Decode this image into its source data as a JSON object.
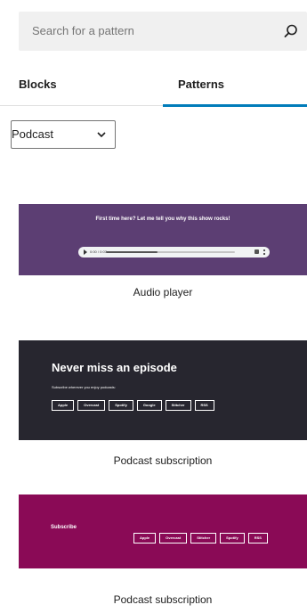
{
  "search": {
    "placeholder": "Search for a pattern",
    "icon": "search-icon"
  },
  "tabs": [
    {
      "label": "Blocks",
      "active": false
    },
    {
      "label": "Patterns",
      "active": true
    }
  ],
  "tab_accent_color": "#007cba",
  "category_select": {
    "value": "Podcast"
  },
  "patterns": [
    {
      "name": "Audio player",
      "background": "#5c3e73",
      "headline": "First time here? Let me tell you why this show rocks!",
      "time": "0:00 / 0:07"
    },
    {
      "name": "Podcast subscription",
      "background": "#27262f",
      "title": "Never miss an episode",
      "description": "Subscribe wherever you enjoy podcasts:",
      "buttons": [
        "Apple",
        "Overcast",
        "Spotify",
        "Google",
        "Stitcher",
        "RSS"
      ]
    },
    {
      "name": "Podcast subscription",
      "background": "#8a0a56",
      "title": "Subscribe",
      "buttons": [
        "Apple",
        "Overcast",
        "Stitcher",
        "Spotify",
        "RSS"
      ]
    }
  ]
}
